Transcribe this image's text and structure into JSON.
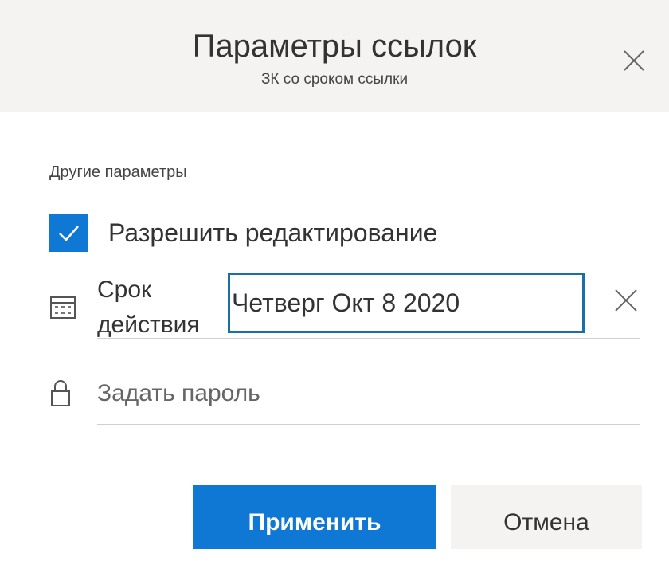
{
  "dialog": {
    "title": "Параметры ссылок",
    "subtitle": "ЗК со сроком ссылки",
    "close_icon": "close-icon"
  },
  "other_settings": {
    "label": "Другие параметры",
    "allow_edit": {
      "label": "Разрешить редактирование",
      "checked": true
    },
    "expiry": {
      "label_line1": "Срок",
      "label_line2": "действия",
      "value": "Четверг Окт 8 2020",
      "icon": "calendar-icon",
      "clear_icon": "close-icon"
    },
    "password": {
      "placeholder": "Задать пароль",
      "icon": "lock-icon"
    }
  },
  "buttons": {
    "apply": "Применить",
    "cancel": "Отмена"
  },
  "colors": {
    "accent": "#0f78d4",
    "header_bg": "#f4f3f2",
    "input_border": "#1a6fa6"
  }
}
